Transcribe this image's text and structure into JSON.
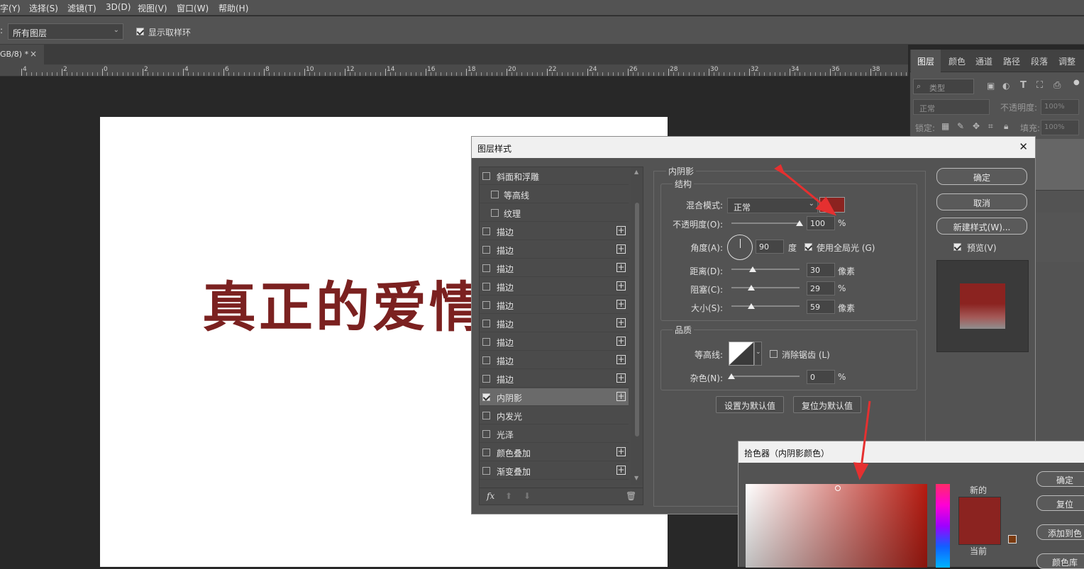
{
  "menubar": {
    "items": [
      "字(Y)",
      "选择(S)",
      "滤镜(T)",
      "3D(D)",
      "视图(V)",
      "窗口(W)",
      "帮助(H)"
    ]
  },
  "options": {
    "prefix": ":",
    "sample_value": "所有图层",
    "show_ring_label": "显示取样环"
  },
  "tab": {
    "title": "GB/8) *",
    "close": "×"
  },
  "ruler": {
    "labels": [
      "4",
      "2",
      "0",
      "2",
      "4",
      "6",
      "8",
      "10",
      "12",
      "14",
      "16",
      "18",
      "20",
      "22",
      "24",
      "26",
      "28",
      "30",
      "32",
      "34",
      "36",
      "38"
    ]
  },
  "document": {
    "text": "真正的爱情"
  },
  "right_panel": {
    "tabs": [
      "图层",
      "颜色",
      "通道",
      "路径",
      "段落",
      "调整"
    ],
    "filter_placeholder": "类型",
    "blend": "正常",
    "opacity_label": "不透明度:",
    "opacity_value": "100%",
    "lock_label": "锁定:",
    "fill_label": "填充:",
    "fill_value": "100%"
  },
  "layer_style": {
    "title": "图层样式",
    "close": "✕",
    "effects": [
      {
        "label": "斜面和浮雕",
        "checked": false,
        "plus": false,
        "indent": false
      },
      {
        "label": "等高线",
        "checked": false,
        "plus": false,
        "indent": true
      },
      {
        "label": "纹理",
        "checked": false,
        "plus": false,
        "indent": true
      },
      {
        "label": "描边",
        "checked": false,
        "plus": true,
        "indent": false
      },
      {
        "label": "描边",
        "checked": false,
        "plus": true,
        "indent": false
      },
      {
        "label": "描边",
        "checked": false,
        "plus": true,
        "indent": false
      },
      {
        "label": "描边",
        "checked": false,
        "plus": true,
        "indent": false
      },
      {
        "label": "描边",
        "checked": false,
        "plus": true,
        "indent": false
      },
      {
        "label": "描边",
        "checked": false,
        "plus": true,
        "indent": false
      },
      {
        "label": "描边",
        "checked": false,
        "plus": true,
        "indent": false
      },
      {
        "label": "描边",
        "checked": false,
        "plus": true,
        "indent": false
      },
      {
        "label": "描边",
        "checked": false,
        "plus": true,
        "indent": false
      },
      {
        "label": "内阴影",
        "checked": true,
        "plus": true,
        "indent": false,
        "active": true
      },
      {
        "label": "内发光",
        "checked": false,
        "plus": false,
        "indent": false
      },
      {
        "label": "光泽",
        "checked": false,
        "plus": false,
        "indent": false
      },
      {
        "label": "颜色叠加",
        "checked": false,
        "plus": true,
        "indent": false
      },
      {
        "label": "渐变叠加",
        "checked": false,
        "plus": true,
        "indent": false
      }
    ],
    "section_title": "内阴影",
    "structure_title": "结构",
    "blend_label": "混合模式:",
    "blend_value": "正常",
    "shadow_color": "#8b2320",
    "opacity_label": "不透明度(O):",
    "opacity_value": "100",
    "opacity_unit": "%",
    "angle_label": "角度(A):",
    "angle_value": "90",
    "angle_unit": "度",
    "global_light_label": "使用全局光 (G)",
    "distance_label": "距离(D):",
    "distance_value": "30",
    "distance_unit": "像素",
    "choke_label": "阻塞(C):",
    "choke_value": "29",
    "choke_unit": "%",
    "size_label": "大小(S):",
    "size_value": "59",
    "size_unit": "像素",
    "quality_title": "品质",
    "contour_label": "等高线:",
    "antialias_label": "消除锯齿 (L)",
    "noise_label": "杂色(N):",
    "noise_value": "0",
    "noise_unit": "%",
    "set_default": "设置为默认值",
    "reset_default": "复位为默认值",
    "ok": "确定",
    "cancel": "取消",
    "new_style": "新建样式(W)...",
    "preview_label": "预览(V)"
  },
  "color_picker": {
    "title": "拾色器（内阴影颜色）",
    "new_label": "新的",
    "current_label": "当前",
    "ok": "确定",
    "reset": "复位",
    "add_to_swatches": "添加到色",
    "color_lib": "颜色库",
    "color": "#8b2320"
  }
}
